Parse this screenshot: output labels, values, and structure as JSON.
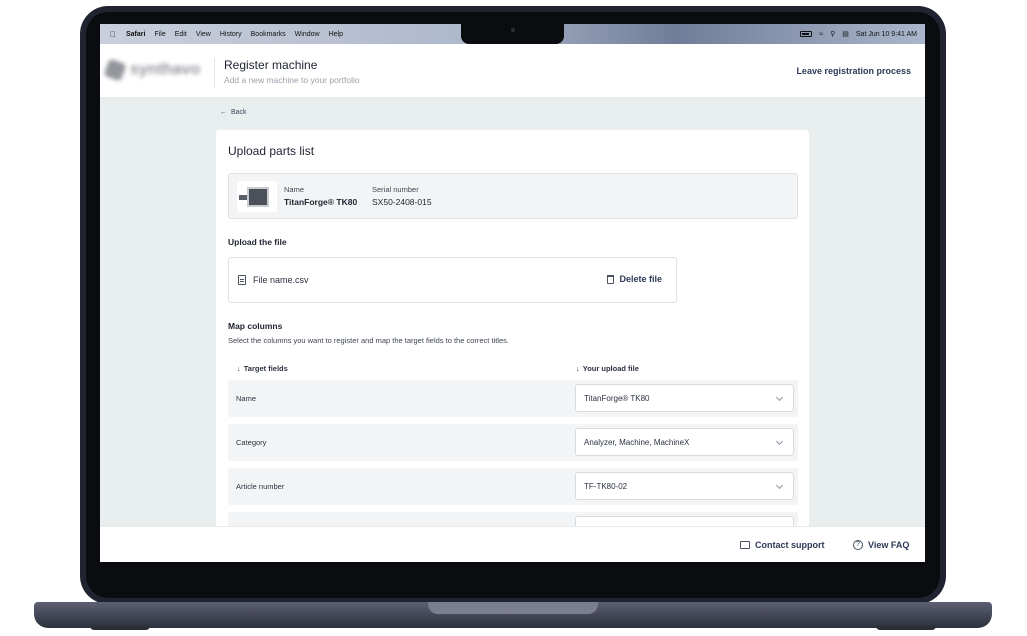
{
  "menubar": {
    "app": "Safari",
    "items": [
      "File",
      "Edit",
      "View",
      "History",
      "Bookmarks",
      "Window",
      "Help"
    ],
    "datetime": "Sat Jun 10  9:41 AM"
  },
  "header": {
    "logo_text": "synthavo",
    "title": "Register machine",
    "subtitle": "Add a new machine to your portfolio",
    "leave_label": "Leave registration process"
  },
  "back_label": "Back",
  "card": {
    "title": "Upload parts list",
    "machine": {
      "name_label": "Name",
      "name_value": "TitanForge® TK80",
      "serial_label": "Serial number",
      "serial_value": "SX50-2408-015"
    },
    "upload": {
      "title": "Upload the file",
      "file_name": "File name.csv",
      "delete_label": "Delete file"
    },
    "map": {
      "title": "Map columns",
      "description": "Select the columns you want to register and map the target fields to the correct titles.",
      "target_header": "Target fields",
      "upload_header": "Your upload file",
      "rows": [
        {
          "label": "Name",
          "value": "TitanForge® TK80"
        },
        {
          "label": "Category",
          "value": "Analyzer, Machine, MachineX"
        },
        {
          "label": "Article number",
          "value": "TF-TK80-02"
        },
        {
          "label": "",
          "value": ""
        }
      ]
    }
  },
  "footer": {
    "contact_label": "Contact support",
    "faq_label": "View FAQ"
  }
}
